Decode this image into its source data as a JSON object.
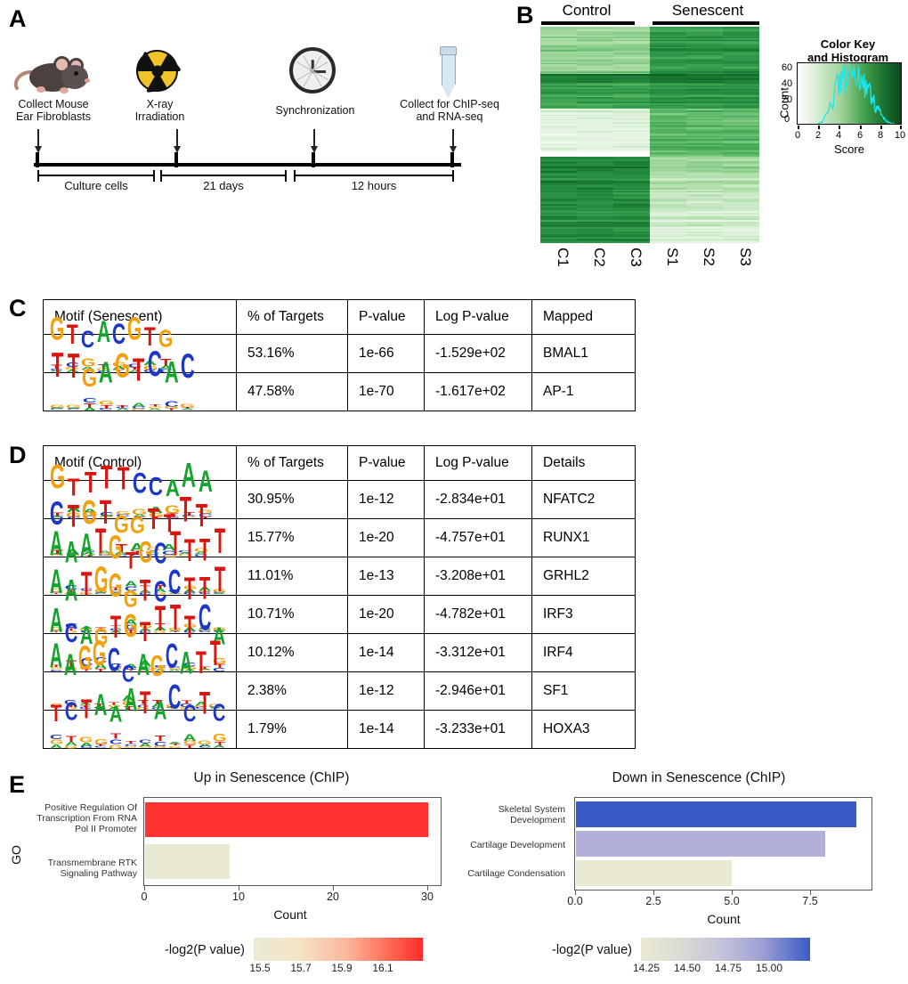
{
  "panels": {
    "a": {
      "letter": "A"
    },
    "b": {
      "letter": "B"
    },
    "c": {
      "letter": "C"
    },
    "d": {
      "letter": "D"
    },
    "e": {
      "letter": "E"
    }
  },
  "timeline": {
    "nodes": [
      {
        "icon": "mouse-icon",
        "caption": "Collect Mouse\nEar Fibroblasts"
      },
      {
        "icon": "radiation-icon",
        "caption": "X-ray\nIrradiation"
      },
      {
        "icon": "clock-icon",
        "caption": "Synchronization"
      },
      {
        "icon": "tube-icon",
        "caption": "Collect for ChIP-seq\nand RNA-seq"
      }
    ],
    "segments": [
      {
        "label": "Culture cells"
      },
      {
        "label": "21 days"
      },
      {
        "label": "12 hours"
      }
    ]
  },
  "heatmap": {
    "groups": [
      {
        "label": "Control"
      },
      {
        "label": "Senescent"
      }
    ],
    "samples": [
      "C1",
      "C2",
      "C3",
      "S1",
      "S2",
      "S3"
    ],
    "color_key": {
      "title": "Color Key\nand Histogram",
      "ylabel": "Count",
      "xlabel": "Score",
      "yticks": [
        "0",
        "20",
        "40",
        "60"
      ],
      "xticks": [
        "0",
        "2",
        "4",
        "6",
        "8",
        "10"
      ]
    }
  },
  "table_c": {
    "headers": [
      "Motif (Senescent)",
      "% of Targets",
      "P-value",
      "Log P-value",
      "Mapped"
    ],
    "rows": [
      {
        "motif": "GTCACGTG",
        "targets": "53.16%",
        "pvalue": "1e-66",
        "logp": "-1.529e+02",
        "mapped": "BMAL1"
      },
      {
        "motif": "TTGAGTCAC",
        "targets": "47.58%",
        "pvalue": "1e-70",
        "logp": "-1.617e+02",
        "mapped": "AP-1"
      }
    ]
  },
  "table_d": {
    "headers": [
      "Motif (Control)",
      "% of Targets",
      "P-value",
      "Log P-value",
      "Details"
    ],
    "rows": [
      {
        "motif": "GTTTTCCAAA",
        "targets": "30.95%",
        "pvalue": "1e-12",
        "logp": "-2.834e+01",
        "mapped": "NFATC2"
      },
      {
        "motif": "CTGTGGTTTT",
        "targets": "15.77%",
        "pvalue": "1e-20",
        "logp": "-4.757e+01",
        "mapped": "RUNX1"
      },
      {
        "motif": "AAATGTGCTTTT",
        "targets": "11.01%",
        "pvalue": "1e-13",
        "logp": "-3.208e+01",
        "mapped": "GRHL2"
      },
      {
        "motif": "AATGGGTCCTTT",
        "targets": "10.71%",
        "pvalue": "1e-20",
        "logp": "-4.782e+01",
        "mapped": "IRF3"
      },
      {
        "motif": "ACAGTGTTTTCA",
        "targets": "10.12%",
        "pvalue": "1e-14",
        "logp": "-3.312e+01",
        "mapped": "IRF4"
      },
      {
        "motif": "AAGGCCAGCATT",
        "targets": "2.38%",
        "pvalue": "1e-12",
        "logp": "-2.946e+01",
        "mapped": "SF1"
      },
      {
        "motif": "TCTAAATACCTC",
        "targets": "1.79%",
        "pvalue": "1e-14",
        "logp": "-3.233e+01",
        "mapped": "HOXA3"
      }
    ]
  },
  "chart_data": [
    {
      "type": "bar",
      "orientation": "horizontal",
      "title": "Up in Senescence (ChIP)",
      "xlabel": "Count",
      "ylabel": "GO",
      "categories": [
        "Positive Regulation Of\nTranscription From RNA\nPol II Promoter",
        "Transmembrane RTK\nSignaling Pathway"
      ],
      "values": [
        30,
        9
      ],
      "xlim": [
        0,
        31.5
      ],
      "xticks": [
        "0",
        "10",
        "20",
        "30"
      ],
      "xtick_values": [
        0,
        10,
        20,
        30
      ],
      "grid": false,
      "bar_colors": [
        "#FF3333",
        "#EAEAD3"
      ],
      "legend": {
        "position": "bottom",
        "title": "-log2(P value)",
        "ticks": [
          "15.5",
          "15.7",
          "15.9",
          "16.1"
        ],
        "tick_values": [
          15.5,
          15.7,
          15.9,
          16.1
        ],
        "range": [
          15.4,
          16.22
        ],
        "gradient_from": "#EAEAD3",
        "gradient_to": "#FF2A2A"
      }
    },
    {
      "type": "bar",
      "orientation": "horizontal",
      "title": "Down in Senescence (ChIP)",
      "xlabel": "Count",
      "ylabel": "GO",
      "categories": [
        "Skeletal System\nDevelopment",
        "Cartilage Development",
        "Cartilage Condensation"
      ],
      "values": [
        9,
        8,
        5
      ],
      "xlim": [
        0,
        9.45
      ],
      "xticks": [
        "0.0",
        "2.5",
        "5.0",
        "7.5"
      ],
      "xtick_values": [
        0,
        2.5,
        5.0,
        7.5
      ],
      "grid": false,
      "bar_colors": [
        "#3A5BC7",
        "#B0B0D8",
        "#EAEAD3"
      ],
      "legend": {
        "position": "bottom",
        "title": "-log2(P value)",
        "ticks": [
          "14.25",
          "14.50",
          "14.75",
          "15.00"
        ],
        "tick_values": [
          14.25,
          14.5,
          14.75,
          15.0
        ],
        "range": [
          14.12,
          15.12
        ],
        "gradient_from": "#EAEAD3",
        "gradient_to": "#3A5BC7"
      }
    }
  ]
}
